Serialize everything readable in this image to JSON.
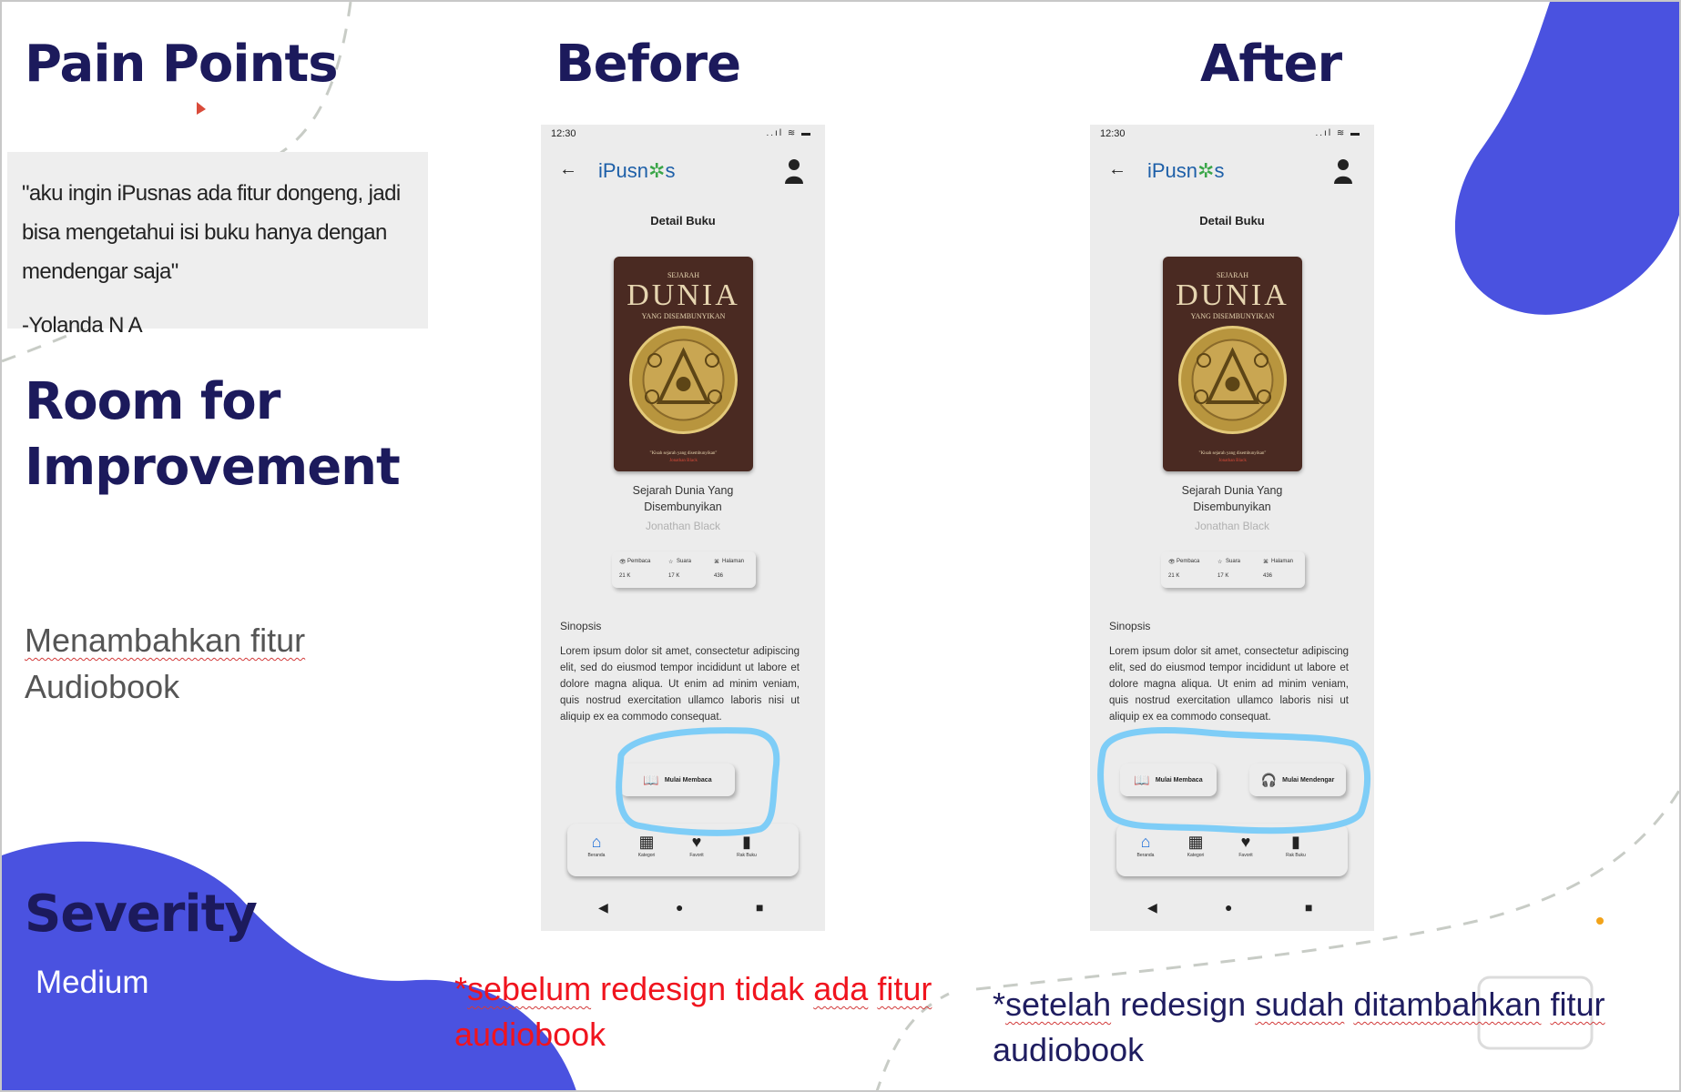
{
  "left_panel": {
    "pain_points_heading": "Pain Points",
    "quote_text": "\"aku ingin iPusnas ada fitur dongeng, jadi bisa mengetahui isi buku hanya dengan mendengar saja\"",
    "quote_author": "-Yolanda N A",
    "room_heading_line1": "Room for",
    "room_heading_line2": "Improvement",
    "improvement_line1": "Menambahkan fitur",
    "improvement_line2": "Audiobook",
    "severity_heading": "Severity",
    "severity_value": "Medium"
  },
  "before": {
    "heading": "Before",
    "note_prefix": "*",
    "note_w1": "sebelum",
    "note_w2": " redesign tidak ",
    "note_w3": "ada",
    "note_w4": " ",
    "note_w5": "fitur",
    "note_w6": "audiobook"
  },
  "after": {
    "heading": "After",
    "note_prefix": "*",
    "note_w1": "setelah",
    "note_w2": " redesign ",
    "note_w3": "sudah",
    "note_w4": " ",
    "note_w5": "ditambahkan",
    "note_w6": " ",
    "note_w7": "fitur",
    "note_w8": "audiobook"
  },
  "phone": {
    "time": "12:30",
    "status_icons": "..ıl ≋ ▬",
    "back_icon": "←",
    "logo_text": "iPusn",
    "logo_star": "✲",
    "logo_end": "s",
    "screen_title": "Detail Buku",
    "cover_small_top": "SEJARAH",
    "cover_big": "DUNIA",
    "cover_small_bottom": "YANG DISEMBUNYIKAN",
    "cover_tagline": "\"Kisah sejarah yang disembunyikan\"",
    "cover_sub": "Jonathan Black",
    "book_title_line1": "Sejarah Dunia Yang",
    "book_title_line2": "Disembunyikan",
    "author": "Jonathan Black",
    "stat_label_1": "Pembaca",
    "stat_label_2": "Suara",
    "stat_label_3": "Halaman",
    "stat_value_1": "21 K",
    "stat_value_2": "17 K",
    "stat_value_3": "436",
    "synopsis_heading": "Sinopsis",
    "synopsis_text": "Lorem ipsum dolor sit amet, consectetur adipiscing elit, sed do eiusmod tempor incididunt ut labore et dolore magna aliqua. Ut enim ad minim veniam, quis nostrud exercitation ullamco laboris nisi ut aliquip ex ea commodo consequat.",
    "read_button": "Mulai Membaca",
    "listen_button": "Mulai Mendengar",
    "nav_home": "Beranda",
    "nav_category": "Kategori",
    "nav_favorite": "Favorit",
    "nav_shelf": "Rak Buku",
    "sys_back": "◀",
    "sys_home": "●",
    "sys_recent": "■"
  },
  "colors": {
    "navy": "#1c1a5c",
    "blob_blue": "#4a52e0",
    "highlight_cyan": "#7ecdf7",
    "note_red": "#f0141e"
  }
}
